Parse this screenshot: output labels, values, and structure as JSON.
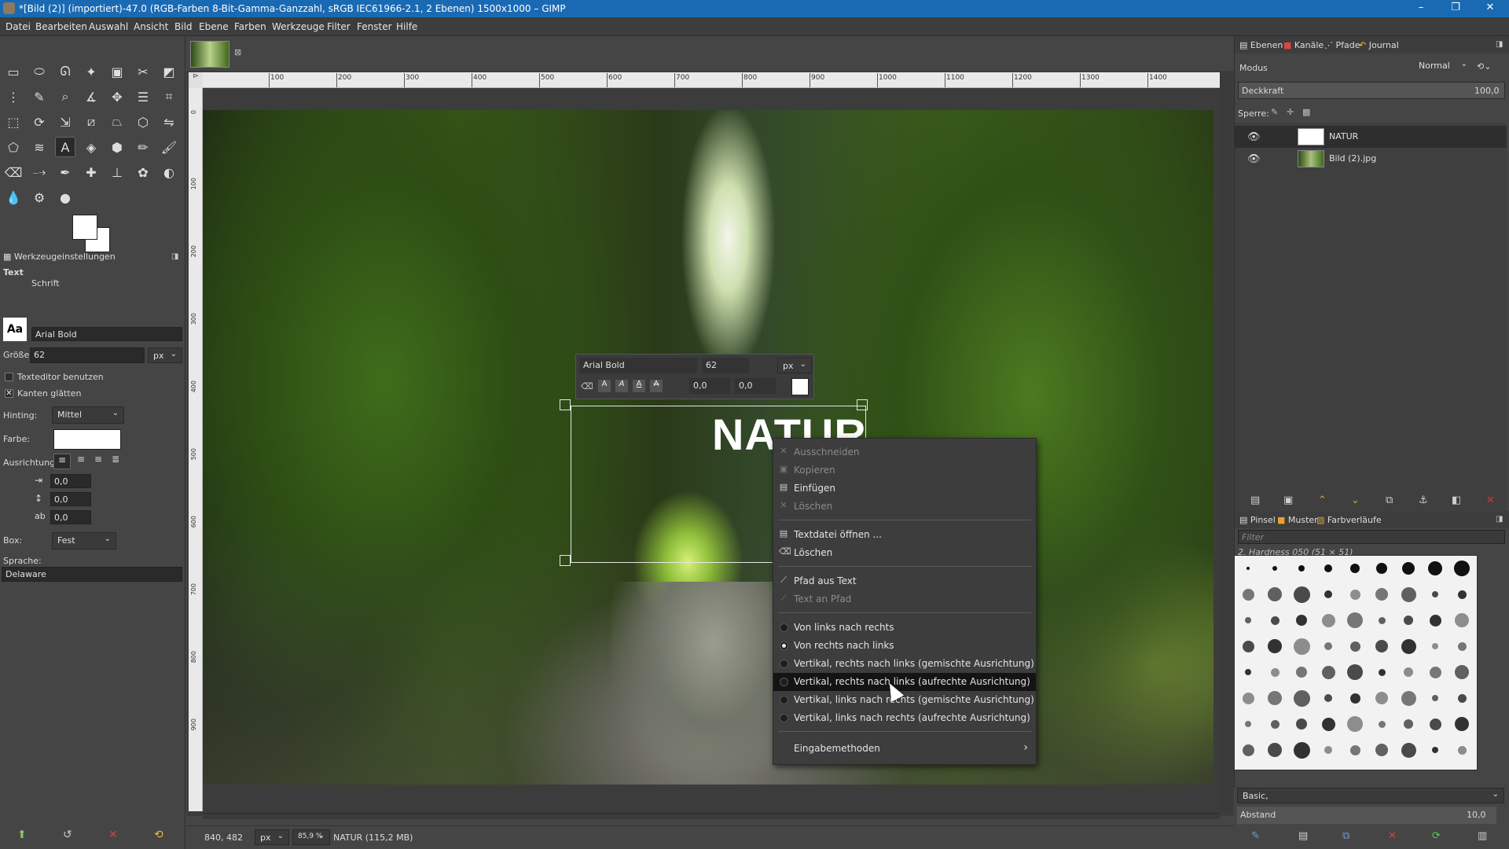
{
  "window": {
    "title": "*[Bild (2)] (importiert)-47.0 (RGB-Farben 8-Bit-Gamma-Ganzzahl, sRGB IEC61966-2.1, 2 Ebenen) 1500x1000 – GIMP",
    "minimize": "–",
    "maximize": "❐",
    "close": "✕"
  },
  "menubar": [
    "Datei",
    "Bearbeiten",
    "Auswahl",
    "Ansicht",
    "Bild",
    "Ebene",
    "Farben",
    "Werkzeuge",
    "Filter",
    "Fenster",
    "Hilfe"
  ],
  "image_tab": {
    "close": "⊠"
  },
  "toolbox": {
    "tools": [
      {
        "name": "rect-select-icon",
        "glyph": "▭"
      },
      {
        "name": "ellipse-select-icon",
        "glyph": "⬭"
      },
      {
        "name": "free-select-icon",
        "glyph": "ᘏ"
      },
      {
        "name": "fuzzy-select-icon",
        "glyph": "✦"
      },
      {
        "name": "select-by-color-icon",
        "glyph": "▣"
      },
      {
        "name": "scissors-select-icon",
        "glyph": "✂"
      },
      {
        "name": "foreground-select-icon",
        "glyph": "◩"
      },
      {
        "name": "paths-icon",
        "glyph": "⋮"
      },
      {
        "name": "color-picker-icon",
        "glyph": "✎"
      },
      {
        "name": "zoom-icon",
        "glyph": "⌕"
      },
      {
        "name": "measure-icon",
        "glyph": "∡"
      },
      {
        "name": "move-icon",
        "glyph": "✥"
      },
      {
        "name": "align-icon",
        "glyph": "☰"
      },
      {
        "name": "crop-icon",
        "glyph": "⌗"
      },
      {
        "name": "unified-transform-icon",
        "glyph": "⬚"
      },
      {
        "name": "rotate-icon",
        "glyph": "⟳"
      },
      {
        "name": "scale-icon",
        "glyph": "⇲"
      },
      {
        "name": "shear-icon",
        "glyph": "⧄"
      },
      {
        "name": "perspective-icon",
        "glyph": "⏢"
      },
      {
        "name": "3d-transform-icon",
        "glyph": "⬡"
      },
      {
        "name": "flip-icon",
        "glyph": "⇋"
      },
      {
        "name": "cage-transform-icon",
        "glyph": "⬠"
      },
      {
        "name": "warp-transform-icon",
        "glyph": "≋"
      },
      {
        "name": "text-tool-icon",
        "glyph": "A"
      },
      {
        "name": "bucket-fill-icon",
        "glyph": "◈"
      },
      {
        "name": "mypaint-brush-icon",
        "glyph": "⬢"
      },
      {
        "name": "pencil-icon",
        "glyph": "✏"
      },
      {
        "name": "paintbrush-icon",
        "glyph": "🖌"
      },
      {
        "name": "eraser-icon",
        "glyph": "⌫"
      },
      {
        "name": "airbrush-icon",
        "glyph": "⤍"
      },
      {
        "name": "ink-icon",
        "glyph": "✒"
      },
      {
        "name": "heal-icon",
        "glyph": "✚"
      },
      {
        "name": "clone-icon",
        "glyph": "⊥"
      },
      {
        "name": "blur-icon",
        "glyph": "✿"
      },
      {
        "name": "dodge-burn-icon",
        "glyph": "◐"
      },
      {
        "name": "smudge-icon",
        "glyph": "💧"
      },
      {
        "name": "gegl-icon",
        "glyph": "⚙"
      },
      {
        "name": "brush-size-icon",
        "glyph": "●"
      }
    ],
    "options_title": "Werkzeugeinstellungen",
    "tool_name": "Text",
    "font_label": "Schrift",
    "font_icon": "Aa",
    "font_value": "Arial Bold",
    "size_label": "Größe:",
    "size_value": "62",
    "size_unit": "px",
    "use_editor": "Texteditor benutzen",
    "antialias": "Kanten glätten",
    "hinting_label": "Hinting:",
    "hinting_value": "Mittel",
    "color_label": "Farbe:",
    "justify_label": "Ausrichtung:",
    "indent_value": "0,0",
    "line_spacing_value": "0,0",
    "letter_spacing_value": "0,0",
    "box_label": "Box:",
    "box_value": "Fest",
    "language_label": "Sprache:",
    "language_value": "Delaware"
  },
  "ruler": {
    "h_labels": [
      "100",
      "200",
      "300",
      "400",
      "500",
      "600",
      "700",
      "800",
      "900",
      "1000",
      "1100",
      "1200",
      "1300",
      "1400"
    ],
    "v_labels": [
      "0",
      "100",
      "200",
      "300",
      "400",
      "500",
      "600",
      "700",
      "800",
      "900"
    ]
  },
  "text_style_overlay": {
    "font": "Arial Bold",
    "size": "62",
    "unit": "px",
    "baseline": "0,0",
    "kerning": "0,0",
    "buttons": [
      "A",
      "A",
      "A",
      "A"
    ]
  },
  "canvas_text": "NATUR",
  "context_menu": [
    {
      "label": "Ausschneiden",
      "icon": "✕",
      "disabled": true
    },
    {
      "label": "Kopieren",
      "icon": "▣",
      "disabled": true
    },
    {
      "label": "Einfügen",
      "icon": "▤",
      "disabled": false
    },
    {
      "label": "Löschen",
      "icon": "✕",
      "disabled": true
    },
    {
      "label": "Textdatei öffnen ...",
      "icon": "▤",
      "disabled": false
    },
    {
      "label": "Löschen",
      "icon": "⌫",
      "disabled": false
    },
    {
      "label": "Pfad aus Text",
      "icon": "⟋",
      "disabled": false
    },
    {
      "label": "Text an Pfad",
      "icon": "⟋",
      "disabled": true
    },
    {
      "label": "Von links nach rechts",
      "radio": true,
      "selected": false
    },
    {
      "label": "Von rechts nach links",
      "radio": true,
      "selected": true
    },
    {
      "label": "Vertikal, rechts nach links (gemischte Ausrichtung)",
      "radio": true,
      "selected": false
    },
    {
      "label": "Vertikal, rechts nach links (aufrechte Ausrichtung)",
      "radio": true,
      "selected": false,
      "highlighted": true
    },
    {
      "label": "Vertikal, links nach rechts (gemischte Ausrichtung)",
      "radio": true,
      "selected": false
    },
    {
      "label": "Vertikal, links nach rechts (aufrechte Ausrichtung)",
      "radio": true,
      "selected": false
    },
    {
      "label": "Eingabemethoden",
      "submenu": "›"
    }
  ],
  "statusbar": {
    "coords": "840, 482",
    "unit": "px",
    "zoom": "85,9 %",
    "info": "NATUR (115,2 MB)"
  },
  "right_dock": {
    "tabs": [
      "Ebenen",
      "Kanäle",
      "Pfade",
      "Journal"
    ],
    "mode_label": "Modus",
    "mode_value": "Normal",
    "opacity_label": "Deckkraft",
    "opacity_value": "100,0",
    "lock_label": "Sperre:",
    "layers": [
      {
        "name": "NATUR",
        "visible": true
      },
      {
        "name": "Bild (2).jpg",
        "visible": true
      }
    ],
    "brush_tabs": [
      "Pinsel",
      "Muster",
      "Farbverläufe"
    ],
    "filter_placeholder": "Filter",
    "brush_name": "2. Hardness 050 (51 × 51)",
    "preset_value": "Basic,",
    "spacing_label": "Abstand",
    "spacing_value": "10,0"
  },
  "colors": {
    "titlebar": "#1a6ab3",
    "panel": "#454545",
    "text_color_swatch": "#ffffff"
  }
}
